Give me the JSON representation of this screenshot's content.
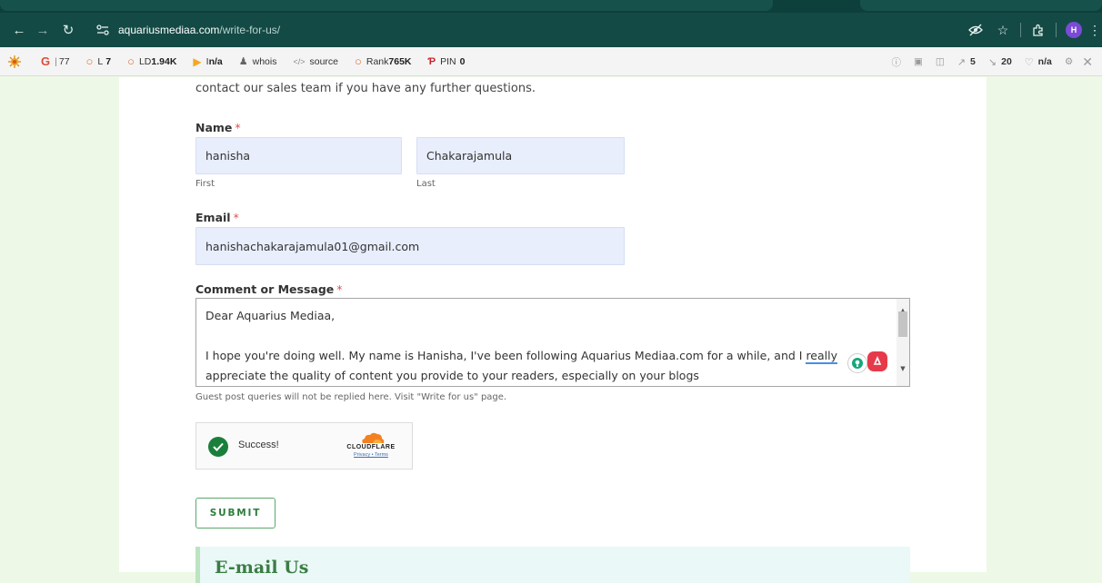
{
  "browser": {
    "url_host": "aquariusmediaa.com",
    "url_path": "/write-for-us/",
    "profile_initial": "H"
  },
  "seo_bar": {
    "items": [
      {
        "icon": "google-icon",
        "prefix": "G",
        "value": "77"
      },
      {
        "icon": "circle-icon",
        "prefix": "L",
        "value": "7"
      },
      {
        "icon": "circle-icon",
        "prefix": "LD",
        "value": "1.94K"
      },
      {
        "icon": "play-icon",
        "prefix": "I",
        "value": "n/a"
      },
      {
        "icon": "person-icon",
        "prefix": "",
        "value": "whois"
      },
      {
        "icon": "code-icon",
        "prefix": "",
        "value": "source"
      },
      {
        "icon": "circle-icon",
        "prefix": "Rank",
        "value": "765K"
      },
      {
        "icon": "pin-icon",
        "prefix": "PIN",
        "value": "0"
      }
    ],
    "right_items": [
      {
        "icon": "info-icon",
        "value": ""
      },
      {
        "icon": "chat-icon",
        "value": ""
      },
      {
        "icon": "bookmark-icon",
        "value": ""
      },
      {
        "icon": "external-link-icon",
        "value": "5"
      },
      {
        "icon": "internal-link-icon",
        "value": "20"
      },
      {
        "icon": "heart-icon",
        "value": "n/a"
      }
    ]
  },
  "form": {
    "intro": "contact our sales team if you have any further questions.",
    "name_label": "Name",
    "required_mark": "*",
    "first_value": "hanisha",
    "last_value": "Chakarajamula",
    "first_sublabel": "First",
    "last_sublabel": "Last",
    "email_label": "Email",
    "email_value": "hanishachakarajamula01@gmail.com",
    "message_label": "Comment or Message",
    "message_line1": "Dear Aquarius Mediaa,",
    "message_line3_a": "I hope you're doing well. My name is Hanisha, I've been following Aquarius Mediaa.com for a while, and I ",
    "message_line3_b": "really",
    "message_line4": "appreciate the quality of content you provide to your readers, especially on your blogs",
    "hint": "Guest post queries will not be replied here. Visit \"Write for us\" page.",
    "captcha_status": "Success!",
    "captcha_brand": "CLOUDFLARE",
    "captcha_links": "Privacy • Terms",
    "submit_label": "SUBMIT"
  },
  "section": {
    "email_heading": "E-mail Us"
  },
  "colors": {
    "chrome_toolbar": "#144a45",
    "page_bg": "#eef8e6",
    "input_bg": "#e8eefc",
    "accent_green": "#2e7d3e",
    "required_red": "#e04e4e"
  }
}
